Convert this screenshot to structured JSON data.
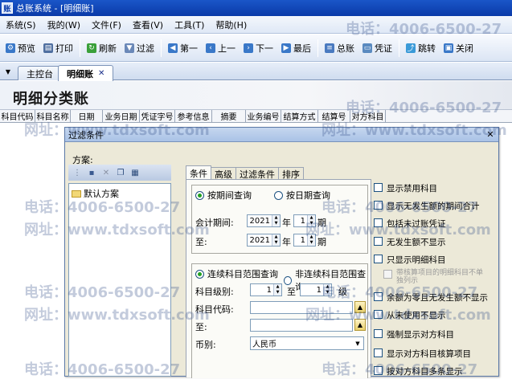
{
  "window": {
    "title": "总账系统 - [明细账]",
    "app_icon": "账"
  },
  "menu": [
    "系统(S)",
    "我的(W)",
    "文件(F)",
    "查看(V)",
    "工具(T)",
    "帮助(H)"
  ],
  "toolbar": [
    {
      "label": "预览",
      "icon": "preview-icon",
      "color": "#3a78c8"
    },
    {
      "label": "打印",
      "icon": "printer-icon",
      "color": "#4f6fa0"
    },
    {
      "label": "刷新",
      "icon": "refresh-icon",
      "color": "#3aa03a"
    },
    {
      "label": "过滤",
      "icon": "filter-icon",
      "color": "#6a88b8"
    },
    {
      "label": "第一",
      "icon": "first-icon",
      "color": "#3a78c8"
    },
    {
      "label": "上一",
      "icon": "prev-icon",
      "color": "#3a78c8"
    },
    {
      "label": "下一",
      "icon": "next-icon",
      "color": "#3a78c8"
    },
    {
      "label": "最后",
      "icon": "last-icon",
      "color": "#3a78c8"
    },
    {
      "label": "总账",
      "icon": "ledger-icon",
      "color": "#4a7ac0"
    },
    {
      "label": "凭证",
      "icon": "voucher-icon",
      "color": "#5a8ac0"
    },
    {
      "label": "跳转",
      "icon": "jump-icon",
      "color": "#3a9ad8"
    },
    {
      "label": "关闭",
      "icon": "close-doc-icon",
      "color": "#3a78c8"
    }
  ],
  "tabs": [
    {
      "label": "主控台",
      "active": false
    },
    {
      "label": "明细账",
      "active": true
    }
  ],
  "page_title": "明细分类账",
  "columns": [
    "科目代码",
    "科目名称",
    "日期",
    "业务日期",
    "凭证字号",
    "参考信息",
    "摘要",
    "业务编号",
    "结算方式",
    "结算号",
    "对方科目"
  ],
  "watermark": {
    "phone": "电话：4006-6500-27",
    "site": "网址：www.tdxsoft.com"
  },
  "dialog": {
    "title": "过滤条件",
    "scheme_label": "方案:",
    "scheme_items": [
      "默认方案"
    ],
    "tabs": [
      "条件",
      "高级",
      "过滤条件",
      "排序"
    ],
    "period": {
      "radio_period": "按期间查询",
      "radio_date": "按日期查询",
      "period_label": "会计期间:",
      "to_label": "至:",
      "from_year": "2021",
      "from_period": "1",
      "to_year": "2021",
      "to_period": "1",
      "year_unit": "年",
      "period_unit": "期"
    },
    "account": {
      "radio_continuous": "连续科目范围查询",
      "radio_noncontinuous": "非连续科目范围查询",
      "level_label": "科目级别:",
      "level_from": "1",
      "level_to": "1",
      "level_to_sep": "至",
      "level_unit": "级",
      "code_label": "科目代码:",
      "code_to_label": "至:",
      "currency_label": "币别:",
      "currency_value": "人民币"
    },
    "options": [
      {
        "label": "显示禁用科目",
        "disabled": false
      },
      {
        "label": "显示无发生额的期间合计",
        "disabled": false
      },
      {
        "label": "包括未过账凭证",
        "disabled": false
      },
      {
        "label": "无发生额不显示",
        "disabled": false
      },
      {
        "label": "只显示明细科目",
        "disabled": false
      },
      {
        "label": "带核算项目的明细科目不单独列示",
        "disabled": true
      },
      {
        "label": "余额为零且无发生额不显示",
        "disabled": false
      },
      {
        "label": "从未使用不显示",
        "disabled": false
      },
      {
        "label": "强制显示对方科目",
        "disabled": false
      },
      {
        "label": "显示对方科目核算项目",
        "disabled": false
      },
      {
        "label": "按对方科目多条显示",
        "disabled": false
      }
    ]
  }
}
